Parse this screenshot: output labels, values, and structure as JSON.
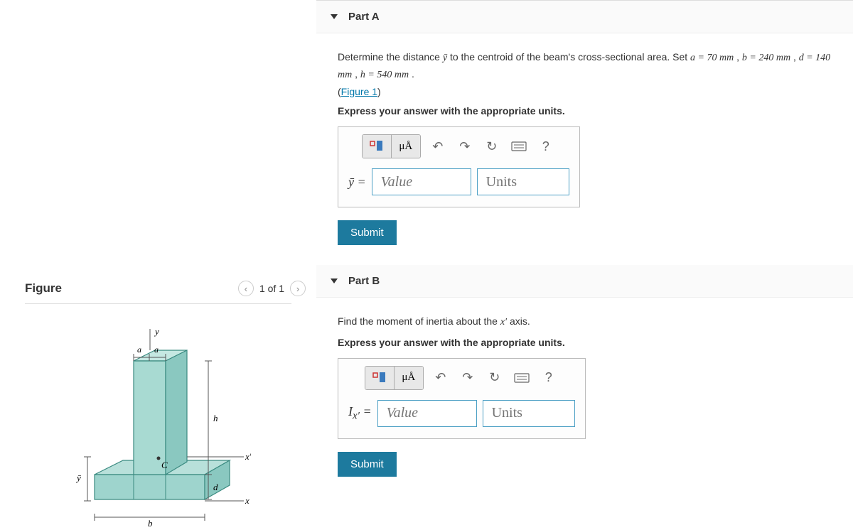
{
  "figure": {
    "title": "Figure",
    "nav_text": "1 of 1",
    "labels": {
      "a1": "a",
      "a2": "a",
      "y": "y",
      "h": "h",
      "d": "d",
      "b": "b",
      "x": "x",
      "xp": "x'",
      "C": "C",
      "ybar": "ȳ"
    }
  },
  "partA": {
    "title": "Part A",
    "prompt_pre": "Determine the distance ",
    "prompt_var": "ȳ",
    "prompt_mid": " to the centroid of the beam's cross-sectional area. Set ",
    "a": "a = 70 mm",
    "b": "b = 240 mm",
    "d": "d = 140 mm",
    "h": "h = 540 mm",
    "figure_link": "Figure 1",
    "instruction": "Express your answer with the appropriate units.",
    "mu_label": "μÅ",
    "var_label": "ȳ =",
    "value_ph": "Value",
    "units_ph": "Units",
    "submit": "Submit"
  },
  "partB": {
    "title": "Part B",
    "prompt_pre": "Find the moment of inertia about the ",
    "prompt_var": "x′",
    "prompt_post": " axis.",
    "instruction": "Express your answer with the appropriate units.",
    "mu_label": "μÅ",
    "var_label_pre": "I",
    "var_label_sub": "x′",
    "var_label_post": " =",
    "value_ph": "Value",
    "units_ph": "Units",
    "submit": "Submit"
  },
  "icons": {
    "help": "?"
  }
}
